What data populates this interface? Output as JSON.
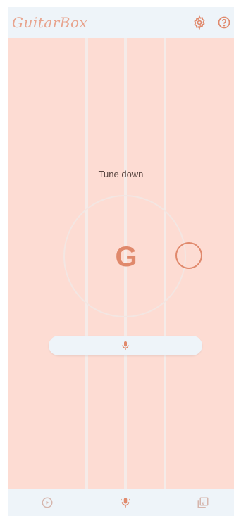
{
  "app": {
    "logo": "GuitarBox"
  },
  "header": {
    "icons": [
      "gear-icon",
      "help-circle-icon"
    ]
  },
  "tuner": {
    "hint": "Tune down",
    "note": "G"
  },
  "mic_button": {
    "icon": "microphone-icon"
  },
  "bottom_nav": {
    "items": [
      {
        "icon": "play-circle-icon"
      },
      {
        "icon": "microphone-icon",
        "active": true
      },
      {
        "icon": "music-library-icon"
      }
    ]
  },
  "colors": {
    "background": "#fddcd3",
    "bar": "#eef4f9",
    "accent": "#e0896c",
    "string": "#f5ebe8"
  }
}
